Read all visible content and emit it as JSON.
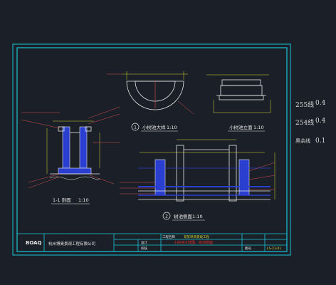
{
  "colors": {
    "background": "#1b1f27",
    "frame": "#18c8d8",
    "line": "#e8e8e8",
    "hatch": "#2a3fd0",
    "dimension": "#d8d830",
    "callout": "#d85050",
    "accent_red": "#e03030"
  },
  "legend": [
    {
      "name": "255线",
      "value": "0.4"
    },
    {
      "name": "254线",
      "value": "0.4"
    },
    {
      "name": "黑余线",
      "value": "0.1"
    }
  ],
  "views": {
    "plan_title": "小树池大样",
    "plan_scale": "1:10",
    "plan_number": "1",
    "elevation_title": "小树池立面",
    "elevation_scale": "1:10",
    "section11_title": "1-1 剖面",
    "section11_scale": "1:10",
    "side_title": "树池侧面",
    "side_scale": "1:10",
    "side_number": "2"
  },
  "title_block": {
    "logo": "BOAQ",
    "company": "杭州博奥景观工程有限公司",
    "project_label": "工程名称",
    "project_name": "某某项目景观工程",
    "drawing_name": "小树池大样图、树池侧面",
    "designer_label": "设计",
    "checker_label": "校核",
    "drawing_no_label": "图号",
    "drawing_no": "LS-21-01"
  }
}
